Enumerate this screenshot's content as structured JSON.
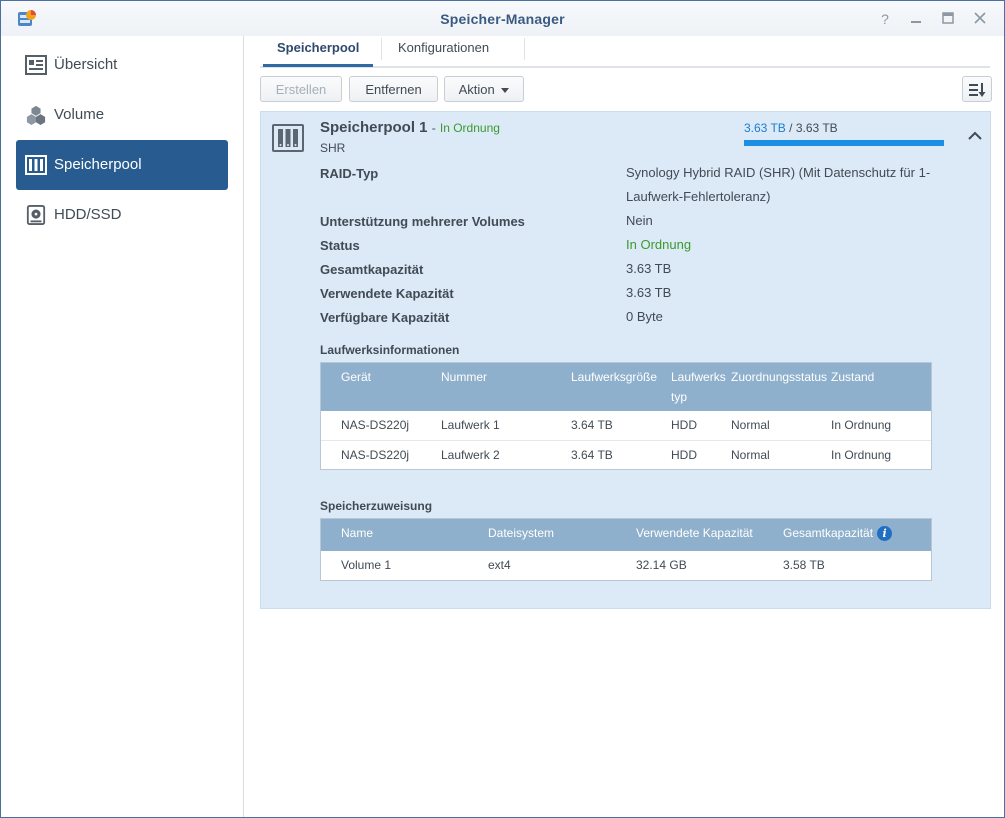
{
  "window": {
    "title": "Speicher-Manager"
  },
  "sidebar": {
    "items": [
      {
        "label": "Übersicht",
        "icon": "overview-icon"
      },
      {
        "label": "Volume",
        "icon": "cubes-icon"
      },
      {
        "label": "Speicherpool",
        "icon": "storage-pool-icon",
        "active": true
      },
      {
        "label": "HDD/SSD",
        "icon": "disk-icon"
      }
    ]
  },
  "tabs": [
    {
      "label": "Speicherpool",
      "active": true
    },
    {
      "label": "Konfigurationen"
    }
  ],
  "toolbar": {
    "create_label": "Erstellen",
    "remove_label": "Entfernen",
    "action_label": "Aktion"
  },
  "pool": {
    "name": "Speicherpool 1",
    "dash": "-",
    "status": "In Ordnung",
    "type": "SHR",
    "capacity_used": "3.63 TB",
    "capacity_sep": "/",
    "capacity_total": "3.63 TB",
    "usage_fraction": 1.0,
    "properties": [
      {
        "label": "RAID-Typ",
        "value": "Synology Hybrid RAID (SHR) (Mit Datenschutz für 1-Laufwerk-Fehlertoleranz)"
      },
      {
        "label": "Unterstützung mehrerer Volumes",
        "value": "Nein"
      },
      {
        "label": "Status",
        "value": "In Ordnung",
        "status": true
      },
      {
        "label": "Gesamtkapazität",
        "value": "3.63 TB"
      },
      {
        "label": "Verwendete Kapazität",
        "value": "3.63 TB"
      },
      {
        "label": "Verfügbare Kapazität",
        "value": "0 Byte"
      }
    ]
  },
  "drives": {
    "title": "Laufwerksinformationen",
    "columns": [
      "Gerät",
      "Nummer",
      "Laufwerksgröße",
      "Laufwerks typ",
      "Zuordnungsstatus",
      "Zustand"
    ],
    "rows": [
      [
        "NAS-DS220j",
        "Laufwerk 1",
        "3.64 TB",
        "HDD",
        "Normal",
        "In Ordnung"
      ],
      [
        "NAS-DS220j",
        "Laufwerk 2",
        "3.64 TB",
        "HDD",
        "Normal",
        "In Ordnung"
      ]
    ]
  },
  "allocation": {
    "title": "Speicherzuweisung",
    "columns": [
      "Name",
      "Dateisystem",
      "Verwendete Kapazität",
      "Gesamtkapazität"
    ],
    "rows": [
      [
        "Volume 1",
        "ext4",
        "32.14 GB",
        "3.58 TB"
      ]
    ]
  },
  "colors": {
    "accent": "#285b8f",
    "ok": "#3b9b2e",
    "usage_bar": "#1a8fe3"
  }
}
